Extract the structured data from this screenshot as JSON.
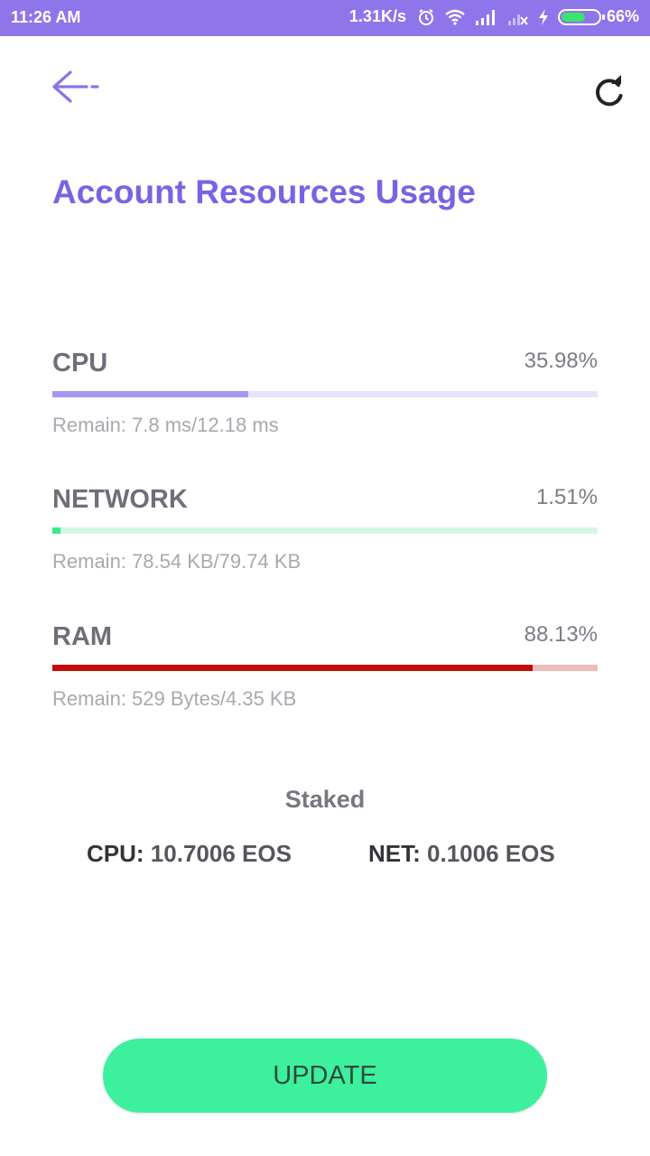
{
  "status_bar": {
    "time": "11:26 AM",
    "speed": "1.31K/s",
    "battery": "66%",
    "battery_level": 0.66,
    "icons": [
      "alarm-icon",
      "wifi-icon",
      "signal-icon",
      "signal-off-icon",
      "charging-icon",
      "battery-icon"
    ]
  },
  "header": {
    "back_icon": "arrow-left-icon",
    "refresh_icon": "refresh-icon",
    "title": "Account Resources Usage"
  },
  "resources": [
    {
      "label": "CPU",
      "percent_text": "35.98%",
      "percent": 35.98,
      "remain": "Remain: 7.8 ms/12.18 ms",
      "fill_color": "#a896f2",
      "track_color": "#e7e3fb"
    },
    {
      "label": "NETWORK",
      "percent_text": "1.51%",
      "percent": 1.51,
      "remain": "Remain: 78.54 KB/79.74 KB",
      "fill_color": "#3ee88c",
      "track_color": "#d2f8e3"
    },
    {
      "label": "RAM",
      "percent_text": "88.13%",
      "percent": 88.13,
      "remain": "Remain: 529 Bytes/4.35 KB",
      "fill_color": "#c30d0d",
      "track_color": "#eebcbc"
    }
  ],
  "staked": {
    "title": "Staked",
    "cpu_label": "CPU:",
    "cpu_value": "10.7006 EOS",
    "net_label": "NET:",
    "net_value": "0.1006 EOS"
  },
  "update_button": {
    "label": "UPDATE",
    "color": "#3cf09d"
  }
}
